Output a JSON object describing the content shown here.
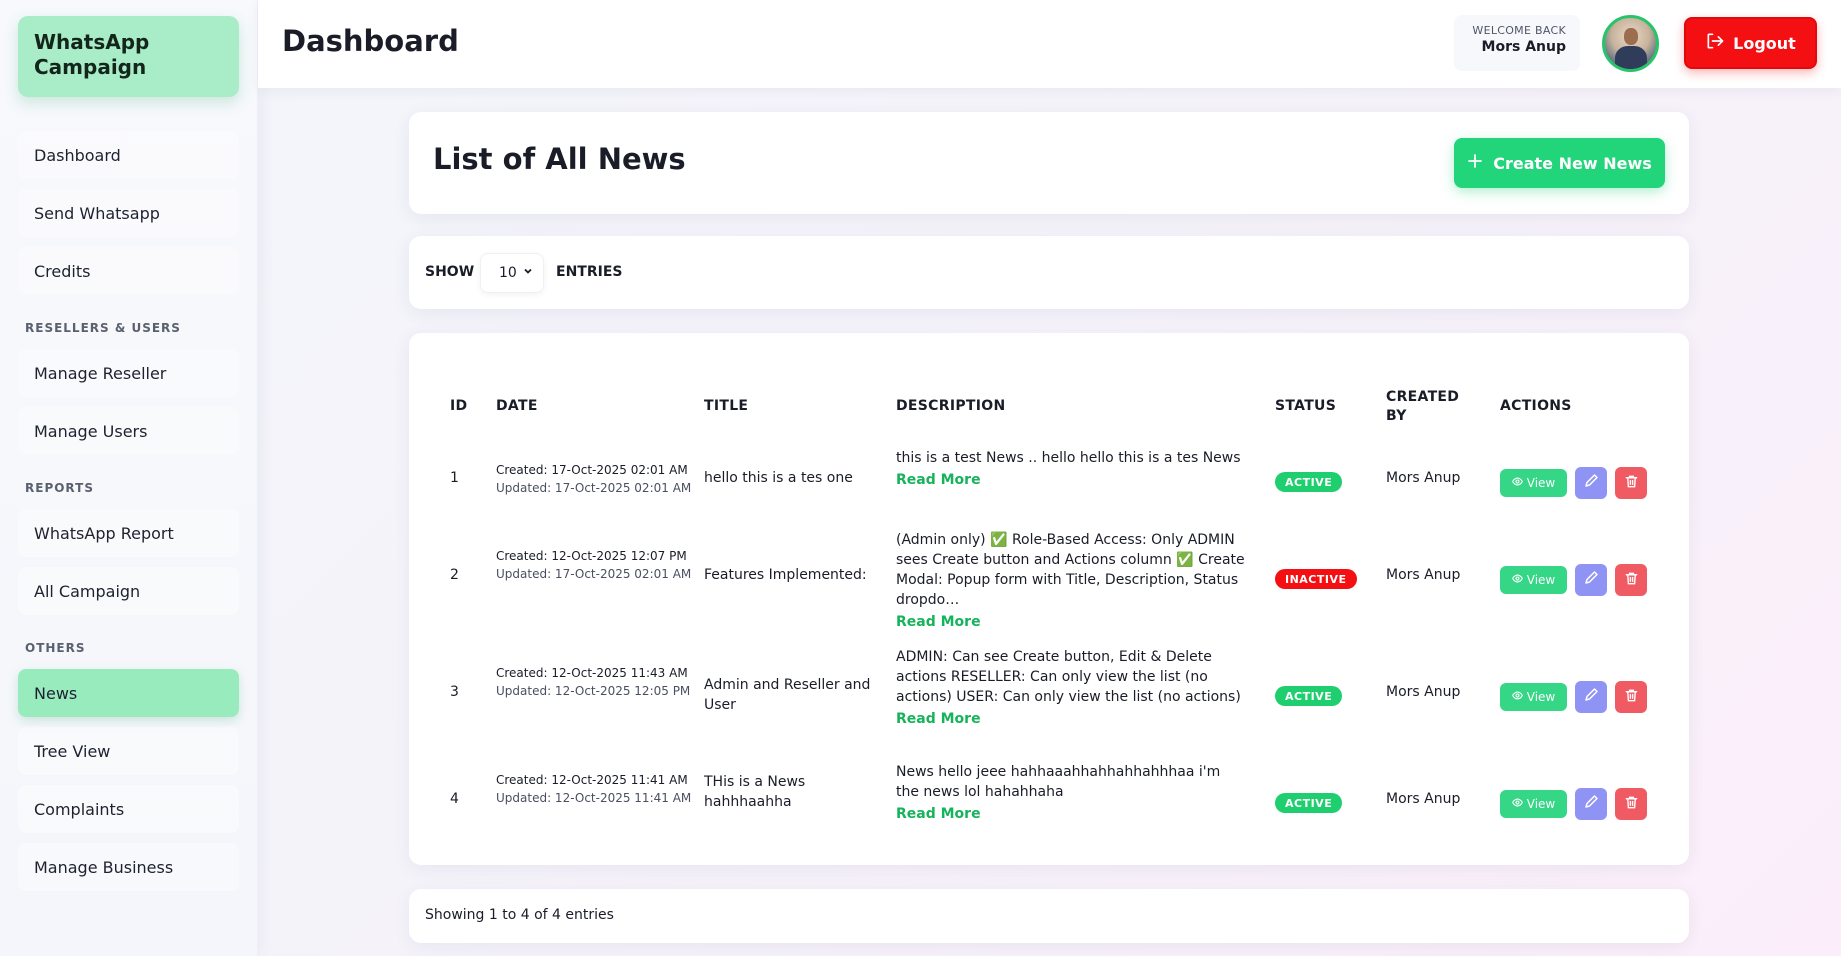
{
  "brand": {
    "line1": "WhatsApp",
    "line2": "Campaign"
  },
  "sidebar": {
    "items": [
      {
        "label": "Dashboard"
      },
      {
        "label": "Send Whatsapp"
      },
      {
        "label": "Credits"
      },
      {
        "label": "Manage Reseller"
      },
      {
        "label": "Manage Users"
      },
      {
        "label": "WhatsApp Report"
      },
      {
        "label": "All Campaign"
      },
      {
        "label": "News"
      },
      {
        "label": "Tree View"
      },
      {
        "label": "Complaints"
      },
      {
        "label": "Manage Business"
      }
    ],
    "sections": [
      "RESELLERS & USERS",
      "REPORTS",
      "OTHERS"
    ],
    "active_item": "News"
  },
  "header": {
    "title": "Dashboard",
    "welcome_label": "WELCOME BACK",
    "user_name": "Mors Anup",
    "logout_label": "Logout"
  },
  "news": {
    "title": "List of All News",
    "create_label": "Create New News"
  },
  "entries": {
    "show_label": "SHOW",
    "value": "10",
    "entries_label": "ENTRIES"
  },
  "table": {
    "headers": [
      "ID",
      "DATE",
      "TITLE",
      "DESCRIPTION",
      "STATUS",
      "CREATED",
      "BY",
      "ACTIONS"
    ],
    "rows": [
      {
        "id": "1",
        "created": "Created: 17-Oct-2025 02:01 AM",
        "updated": "Updated: 17-Oct-2025 02:01 AM",
        "title": "hello this is a tes one",
        "description": "this is a test News .. hello hello this is a tes News",
        "read_more": "Read More",
        "status": "ACTIVE",
        "created_by": "Mors Anup",
        "view_label": "View"
      },
      {
        "id": "2",
        "created": "Created: 12-Oct-2025 12:07 PM",
        "updated": "Updated: 17-Oct-2025 02:01 AM",
        "title": "Features Implemented:",
        "description": "(Admin only) ✅ Role-Based Access: Only ADMIN sees Create button and Actions column ✅ Create Modal: Popup form with Title, Description, Status dropdo…",
        "read_more": "Read More",
        "status": "INACTIVE",
        "created_by": "Mors Anup",
        "view_label": "View"
      },
      {
        "id": "3",
        "created": "Created: 12-Oct-2025 11:43 AM",
        "updated": "Updated: 12-Oct-2025 12:05 PM",
        "title": "Admin and Reseller and User",
        "description": "ADMIN: Can see Create button, Edit & Delete actions RESELLER: Can only view the list (no actions) USER: Can only view the list (no actions)",
        "read_more": "Read More",
        "status": "ACTIVE",
        "created_by": "Mors Anup",
        "view_label": "View"
      },
      {
        "id": "4",
        "created": "Created: 12-Oct-2025 11:41 AM",
        "updated": "Updated: 12-Oct-2025 11:41 AM",
        "title": "THis is a News hahhhaahha",
        "description": "News hello jeee hahhaaahhahhahhahhhaa i'm the news lol hahahhaha",
        "read_more": "Read More",
        "status": "ACTIVE",
        "created_by": "Mors Anup",
        "view_label": "View"
      }
    ]
  },
  "footer": {
    "text": "Showing 1 to 4 of 4 entries"
  },
  "colors": {
    "brand_bg": "#a8edc8",
    "active_nav": "#98ebbd",
    "primary_green": "#22d47a",
    "logout_red": "#f30f12",
    "edit_purple": "#8f93f4",
    "delete_red": "#f05a62"
  },
  "icons": {
    "logout": "logout-icon",
    "create": "plus-icon",
    "view": "eye-icon",
    "edit": "pencil-icon",
    "delete": "trash-icon",
    "select": "chevron-down-icon"
  }
}
